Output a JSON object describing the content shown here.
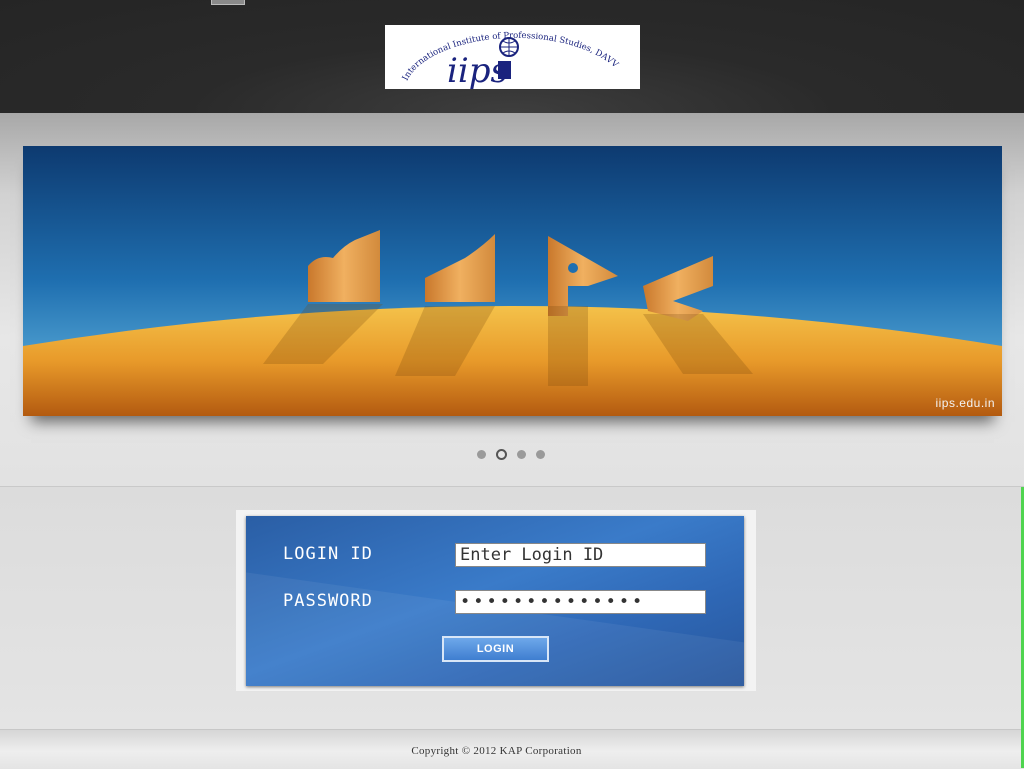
{
  "header": {
    "logo": {
      "main_text": "iips",
      "ring_text": "International Institute of Professional Studies, DAVV"
    }
  },
  "banner": {
    "caption": "iips.edu.in",
    "slide_count": 4,
    "active_slide": 2
  },
  "login": {
    "login_id_label": "LOGIN ID",
    "login_id_value": "Enter Login ID",
    "password_label": "PASSWORD",
    "password_value": "••••••••••••••",
    "button_label": "LOGIN"
  },
  "footer": {
    "copyright": "Copyright © 2012 KAP Corporation"
  },
  "colors": {
    "login_panel": "#2f6bb8",
    "header_bg": "#2a2a2a",
    "logo_ink": "#1a237e"
  }
}
